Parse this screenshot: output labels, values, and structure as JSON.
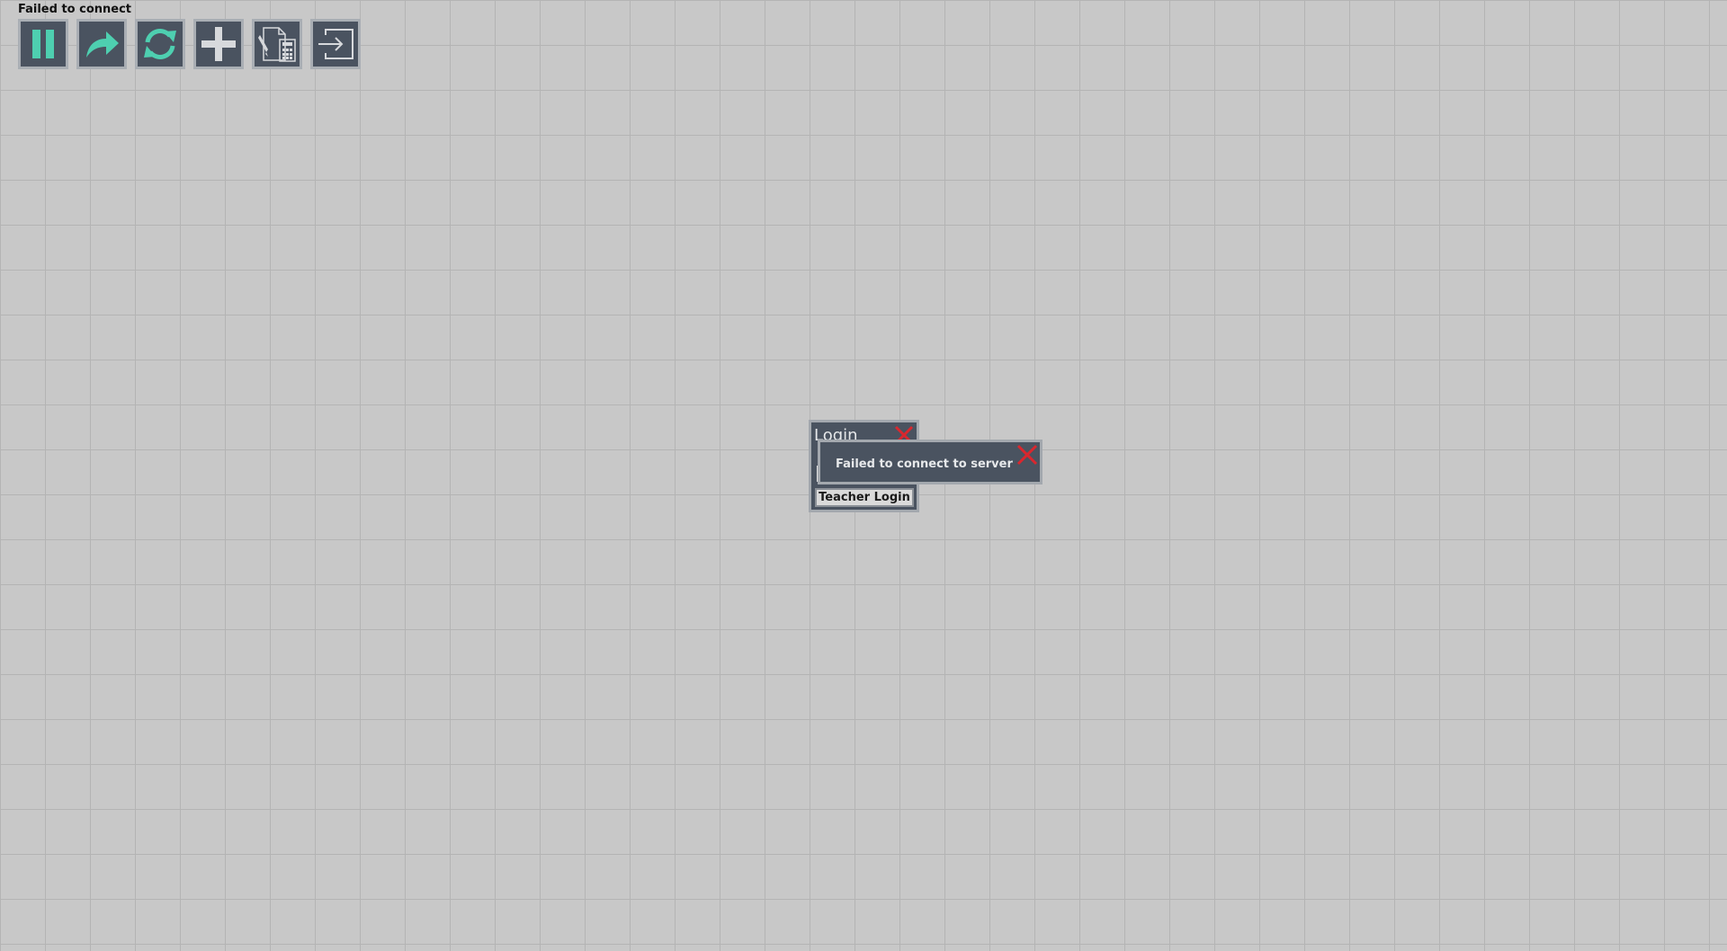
{
  "status": {
    "text": "Failed to connect"
  },
  "toolbar": {
    "buttons": [
      {
        "name": "pause",
        "icon": "pause-icon"
      },
      {
        "name": "share",
        "icon": "share-arrow-icon"
      },
      {
        "name": "refresh",
        "icon": "refresh-icon"
      },
      {
        "name": "add",
        "icon": "plus-icon"
      },
      {
        "name": "calculator",
        "icon": "document-calculator-icon"
      },
      {
        "name": "login",
        "icon": "login-arrow-icon"
      }
    ]
  },
  "colors": {
    "background": "#c8c8c8",
    "grid": "#b4b4b4",
    "panel": "#4a5360",
    "accent": "#4ecfb0",
    "close": "#d9272e"
  },
  "login_window": {
    "title": "Login",
    "teacher_login_label": "Teacher Login"
  },
  "error_dialog": {
    "message": "Failed to connect to server"
  }
}
